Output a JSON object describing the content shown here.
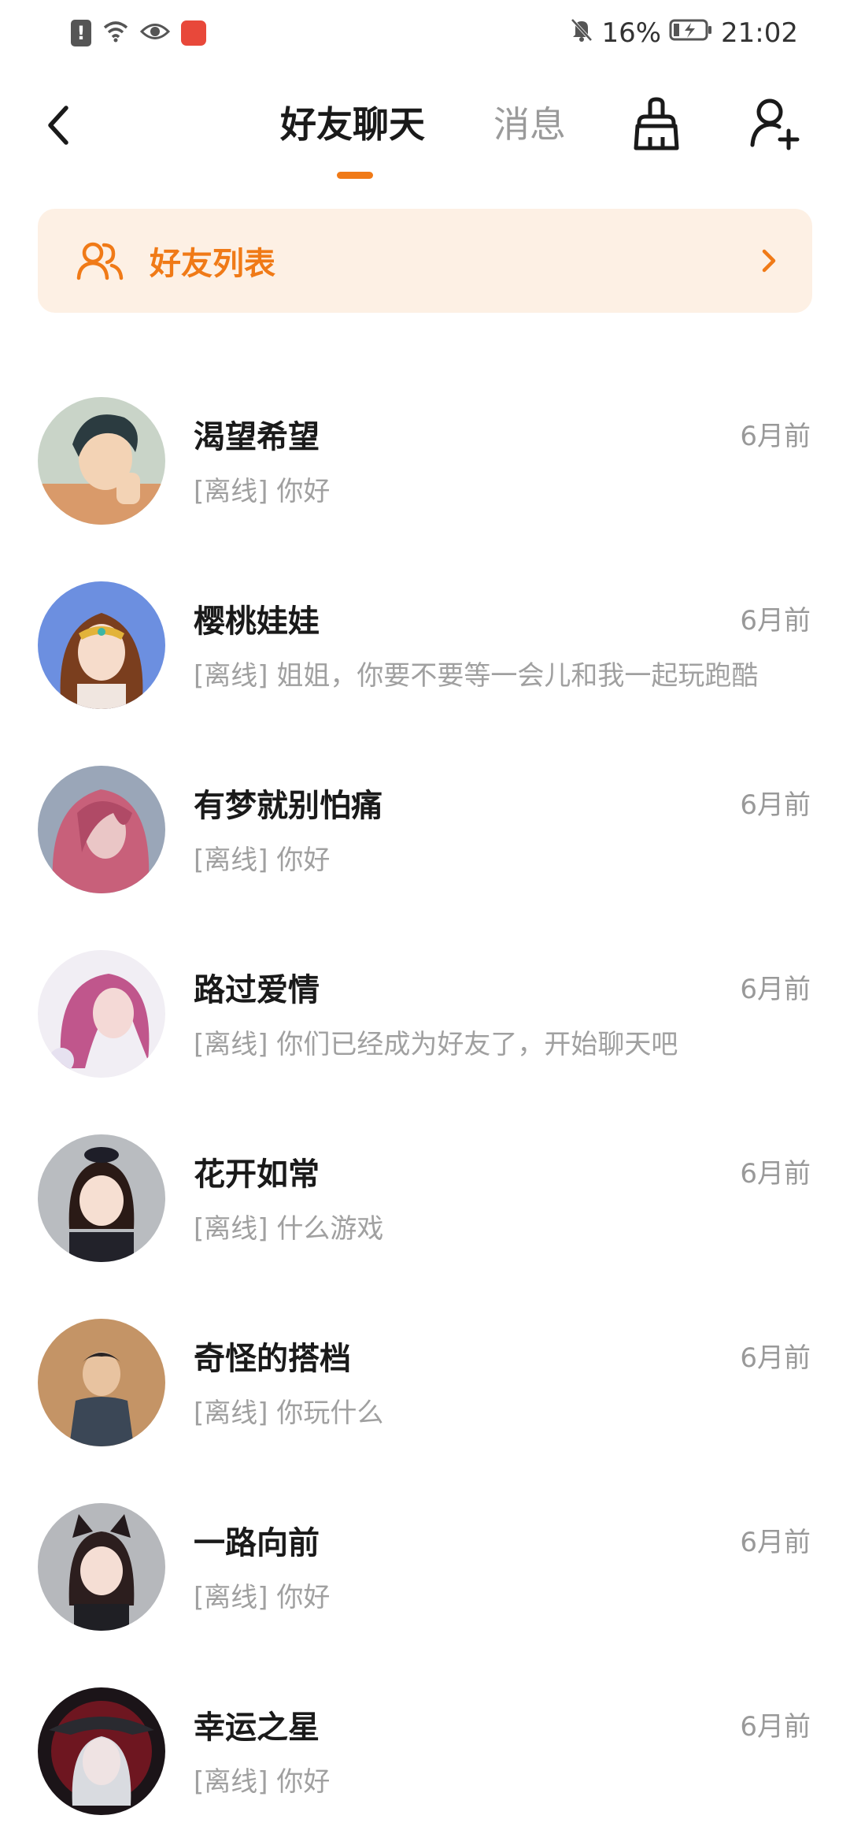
{
  "status_bar": {
    "battery": "16%",
    "time": "21:02",
    "icons": [
      "alert-icon",
      "wifi-icon",
      "eye-icon",
      "app-badge-icon",
      "mute-bell-icon",
      "battery-charging-icon"
    ]
  },
  "nav": {
    "back_icon": "chevron-left-icon",
    "tabs": [
      {
        "label": "好友聊天",
        "active": true
      },
      {
        "label": "消息",
        "active": false
      }
    ],
    "accent": "#f07a17",
    "actions": [
      "broom-clean-icon",
      "add-friend-icon"
    ]
  },
  "banner": {
    "label": "好友列表",
    "icon": "friends-icon",
    "chevron": "chevron-right-icon",
    "bg": "#fdf0e4"
  },
  "chats": [
    {
      "name": "渴望希望",
      "time": "6月前",
      "preview": "[离线] 你好"
    },
    {
      "name": "樱桃娃娃",
      "time": "6月前",
      "preview": "[离线] 姐姐，你要不要等一会儿和我一起玩跑酷"
    },
    {
      "name": "有梦就别怕痛",
      "time": "6月前",
      "preview": "[离线] 你好"
    },
    {
      "name": "路过爱情",
      "time": "6月前",
      "preview": "[离线] 你们已经成为好友了，开始聊天吧"
    },
    {
      "name": "花开如常",
      "time": "6月前",
      "preview": "[离线] 什么游戏"
    },
    {
      "name": "奇怪的搭档",
      "time": "6月前",
      "preview": "[离线] 你玩什么"
    },
    {
      "name": "一路向前",
      "time": "6月前",
      "preview": "[离线] 你好"
    },
    {
      "name": "幸运之星",
      "time": "6月前",
      "preview": "[离线] 你好"
    }
  ]
}
